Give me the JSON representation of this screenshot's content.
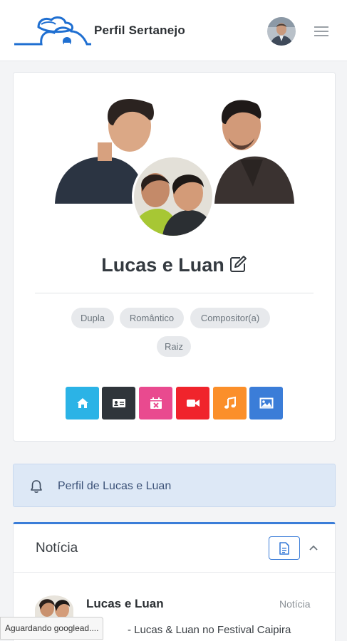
{
  "header": {
    "brand": "Perfil Sertanejo",
    "logo_icon": "guitar-hat-logo",
    "menu_icon": "hamburger-menu-icon",
    "accent": "#1f6fd1"
  },
  "profile": {
    "name": "Lucas e Luan",
    "edit_icon": "edit-icon",
    "tags": [
      "Dupla",
      "Romântico",
      "Compositor(a)",
      "Raiz"
    ],
    "actions": [
      {
        "icon": "home-icon",
        "color": "#2bb3e6"
      },
      {
        "icon": "contact-card-icon",
        "color": "#2f353b"
      },
      {
        "icon": "calendar-icon",
        "color": "#e94a8f"
      },
      {
        "icon": "video-camera-icon",
        "color": "#f0242c"
      },
      {
        "icon": "music-note-icon",
        "color": "#fb8f2a"
      },
      {
        "icon": "image-icon",
        "color": "#3b7dd8"
      }
    ]
  },
  "notice": {
    "icon": "bell-icon",
    "text": "Perfil de Lucas e Luan"
  },
  "news": {
    "title": "Notícia",
    "doc_icon": "document-icon",
    "collapse_icon": "chevron-up-icon",
    "item": {
      "title": "Lucas e Luan",
      "category": "Notícia",
      "description": "- Lucas & Luan no Festival Caipira"
    }
  },
  "status": {
    "text": "Aguardando googlead...."
  }
}
